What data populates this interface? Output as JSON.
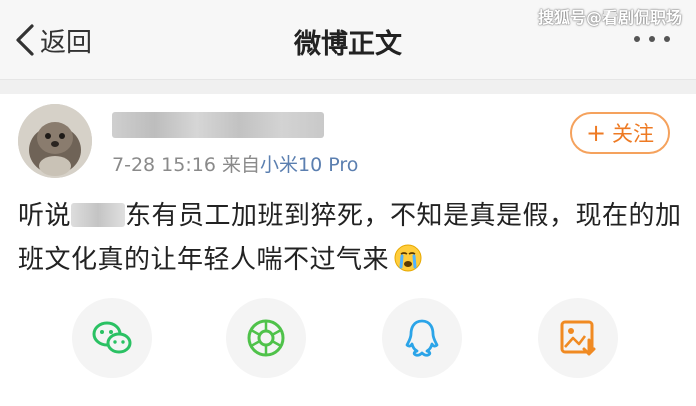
{
  "nav": {
    "back_label": "返回",
    "title": "微博正文",
    "watermark": "搜狐号@看剧侃职场"
  },
  "post": {
    "timestamp": "7-28 15:16",
    "source_prefix": "来自",
    "source_device": "小米10 Pro",
    "follow_label": "关注",
    "text_part1": "听说",
    "text_part2": "东有员工加班到猝死，不知是真是假，现在的加班文化真的让年轻人喘不过气来",
    "emoji": "crying-face-icon"
  },
  "share_buttons": [
    {
      "icon": "wechat-icon",
      "color": "#2ac163"
    },
    {
      "icon": "moments-icon",
      "color": "#4fc24a"
    },
    {
      "icon": "qq-icon",
      "color": "#2ba4e8"
    },
    {
      "icon": "save-image-icon",
      "color": "#f08a22"
    }
  ],
  "colors": {
    "accent_orange": "#ee7a23",
    "device_blue": "#5b7fb0"
  }
}
